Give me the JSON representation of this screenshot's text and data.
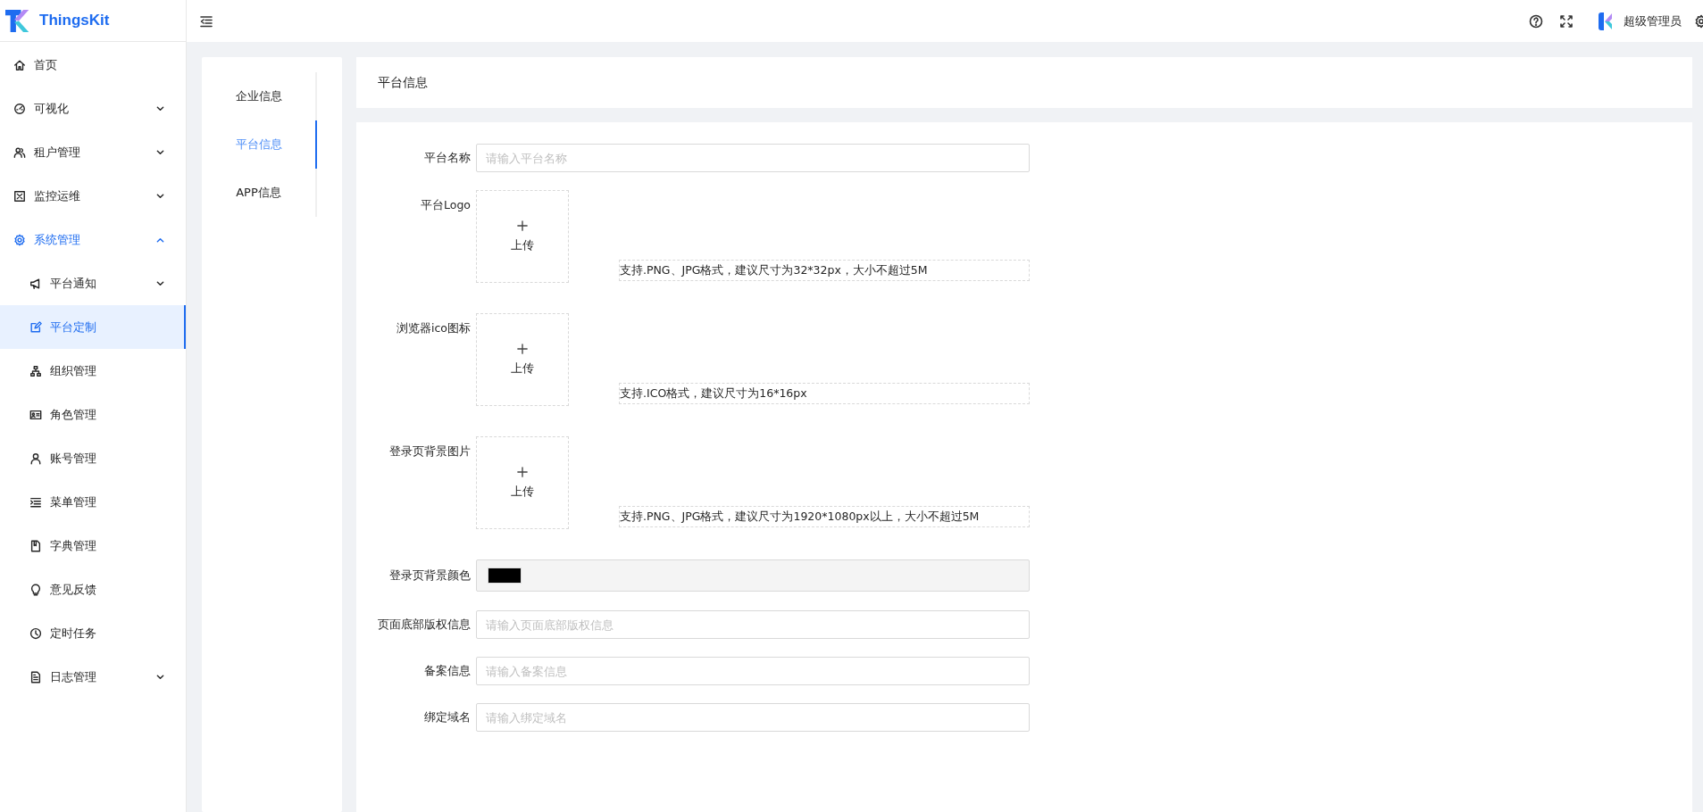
{
  "app": {
    "name": "ThingsKit"
  },
  "header": {
    "user": "超级管理员"
  },
  "sidebar": {
    "items": [
      {
        "label": "首页",
        "selected": false
      },
      {
        "label": "可视化",
        "selected": false,
        "expanded": false
      },
      {
        "label": "租户管理",
        "selected": false,
        "expanded": false
      },
      {
        "label": "监控运维",
        "selected": false,
        "expanded": false
      },
      {
        "label": "系统管理",
        "selected": false,
        "expanded": true,
        "children": [
          {
            "label": "平台通知",
            "selected": false,
            "expanded": false
          },
          {
            "label": "平台定制",
            "selected": true
          },
          {
            "label": "组织管理",
            "selected": false
          },
          {
            "label": "角色管理",
            "selected": false
          },
          {
            "label": "账号管理",
            "selected": false
          },
          {
            "label": "菜单管理",
            "selected": false
          },
          {
            "label": "字典管理",
            "selected": false
          },
          {
            "label": "意见反馈",
            "selected": false
          },
          {
            "label": "定时任务",
            "selected": false
          },
          {
            "label": "日志管理",
            "selected": false,
            "expanded": false
          }
        ]
      }
    ]
  },
  "tabs": [
    {
      "label": "企业信息",
      "selected": false
    },
    {
      "label": "平台信息",
      "selected": true
    },
    {
      "label": "APP信息",
      "selected": false
    }
  ],
  "panel": {
    "title": "平台信息"
  },
  "form": {
    "fields": [
      {
        "kind": "text",
        "label": "平台名称",
        "placeholder": "请输入平台名称"
      },
      {
        "kind": "upload",
        "label": "平台Logo",
        "button": "上传",
        "tip": "支持.PNG、JPG格式，建议尺寸为32*32px，大小不超过5M"
      },
      {
        "kind": "upload",
        "label": "浏览器ico图标",
        "button": "上传",
        "tip": "支持.ICO格式，建议尺寸为16*16px"
      },
      {
        "kind": "upload",
        "label": "登录页背景图片",
        "button": "上传",
        "tip": "支持.PNG、JPG格式，建议尺寸为1920*1080px以上，大小不超过5M"
      },
      {
        "kind": "color",
        "label": "登录页背景颜色",
        "color": "#000000"
      },
      {
        "kind": "text",
        "label": "页面底部版权信息",
        "placeholder": "请输入页面底部版权信息"
      },
      {
        "kind": "text",
        "label": "备案信息",
        "placeholder": "请输入备案信息"
      },
      {
        "kind": "text",
        "label": "绑定域名",
        "placeholder": "请输入绑定域名"
      }
    ]
  }
}
